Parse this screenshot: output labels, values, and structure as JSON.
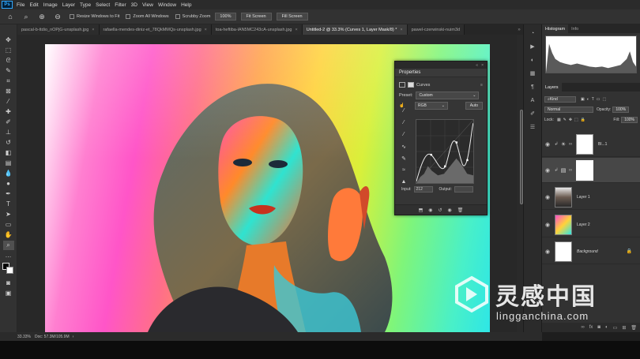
{
  "menu": {
    "app_badge": "Ps",
    "items": [
      "File",
      "Edit",
      "Image",
      "Layer",
      "Type",
      "Select",
      "Filter",
      "3D",
      "View",
      "Window",
      "Help"
    ]
  },
  "options": {
    "resize_windows": "Resize Windows to Fit",
    "zoom_all": "Zoom All Windows",
    "scrubby_zoom": "Scrubby Zoom",
    "zoom_value": "100%",
    "fit_screen": "Fit Screen",
    "fill_screen": "Fill Screen"
  },
  "tabs": [
    "pascal-b-ttdio_nOPjG-unsplash.jpg",
    "rafaella-mendes-diniz-et_78QkMMQs-unsplash.jpg",
    "toa-heftiba-lAN5MC243cA-unsplash.jpg",
    "Untitled-2 @ 33.3% (Curves 1, Layer Mask/8) *",
    "pawel-czerwinski-nuim3d"
  ],
  "properties": {
    "title": "Properties",
    "panel": "Curves",
    "preset_label": "Preset:",
    "preset_value": "Custom",
    "channel": "RGB",
    "auto": "Auto",
    "input_label": "Input:",
    "input_value": "212",
    "output_label": "Output:",
    "output_value": ""
  },
  "right_panel": {
    "histogram_tab": "Histogram",
    "info_tab": "Info",
    "layers_tab": "Layers",
    "kind": "Kind",
    "blend_mode": "Normal",
    "opacity_label": "Opacity:",
    "opacity": "100%",
    "lock_label": "Lock:",
    "fill_label": "Fill:",
    "fill": "100%",
    "layers": [
      {
        "name": "Bl...1",
        "type": "adjust"
      },
      {
        "name": "",
        "type": "curves"
      },
      {
        "name": "Layer 1",
        "type": "photo"
      },
      {
        "name": "Layer 2",
        "type": "gradient"
      },
      {
        "name": "Background",
        "type": "background"
      }
    ]
  },
  "status": {
    "zoom": "33.33%",
    "doc": "Doc: 57.3M/105.9M"
  },
  "watermark": {
    "cn": "灵感中国",
    "en": "lingganchina.com"
  },
  "colors": {
    "accent": "#31a8ff",
    "panel": "#323232"
  }
}
